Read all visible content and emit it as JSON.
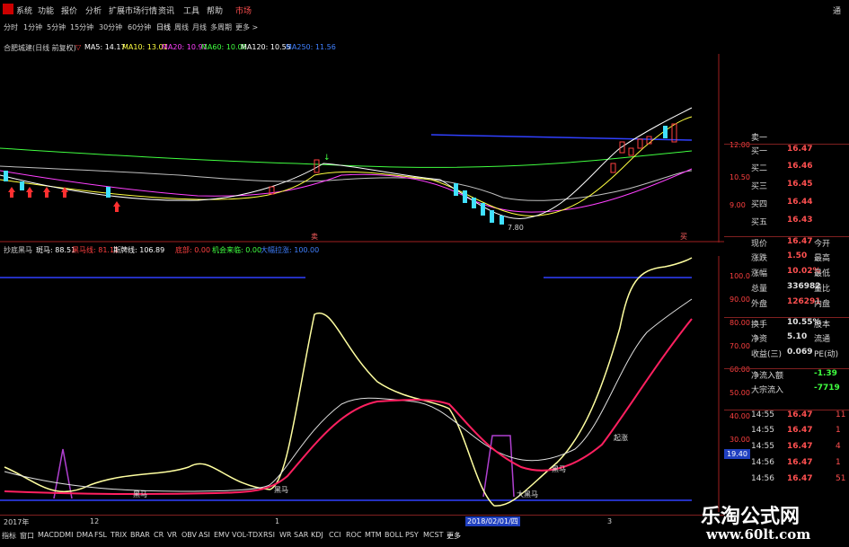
{
  "menubar": {
    "items": [
      "系统",
      "功能",
      "报价",
      "分析",
      "扩展市场行情",
      "资讯",
      "工具",
      "帮助",
      "市场"
    ],
    "right_fragment": "通"
  },
  "periods": [
    "分时",
    "1分钟",
    "5分钟",
    "15分钟",
    "30分钟",
    "60分钟",
    "日线",
    "周线",
    "月线",
    "多周期",
    "更多 >"
  ],
  "main_chart": {
    "title": "合肥城建(日线 前复权)",
    "ma": [
      {
        "label": "MA5: 14.17",
        "color": "#ffffff"
      },
      {
        "label": "MA10: 13.01",
        "color": "#ffff40"
      },
      {
        "label": "MA20: 10.91",
        "color": "#ff40ff"
      },
      {
        "label": "MA60: 10.08",
        "color": "#40ff40"
      },
      {
        "label": "MA120: 10.55",
        "color": "#ffffff"
      },
      {
        "label": "MA250: 11.56",
        "color": "#4080ff"
      }
    ],
    "y_ticks": [
      "12.00",
      "10.50",
      "9.00"
    ],
    "low_label": "7.80",
    "markers": [
      "卖",
      "买"
    ]
  },
  "sub_chart": {
    "name": "抄底黑马",
    "items": [
      {
        "label": "斑马: 88.51",
        "color": "#ffffff"
      },
      {
        "label": "黑马线: 81.11",
        "color": "#ff4040"
      },
      {
        "label": "斯牌线: 106.89",
        "color": "#ffffff"
      },
      {
        "label": "底部: 0.00",
        "color": "#ff4040"
      },
      {
        "label": "机会来临: 0.00",
        "color": "#40ff40"
      },
      {
        "label": "大幅拉涨: 100.00",
        "color": "#4080ff"
      }
    ],
    "y_ticks": [
      "100.0",
      "90.00",
      "80.00",
      "70.00",
      "60.00",
      "50.00",
      "40.00",
      "30.00",
      "19.40"
    ],
    "annotations": [
      "黑马",
      "黑马",
      "大黑马",
      "黑马",
      "起涨"
    ]
  },
  "axis": {
    "dates": [
      "2017年",
      "12",
      "1",
      "2018/02/01/四",
      "3"
    ]
  },
  "bottom_tabs": [
    "指标",
    "窗口",
    "MACD",
    "DMI",
    "DMA",
    "FSL",
    "TRIX",
    "BRAR",
    "CR",
    "VR",
    "OBV",
    "ASI",
    "EMV",
    "VOL-TDX",
    "RSI",
    "WR",
    "SAR",
    "KDJ",
    "CCI",
    "ROC",
    "MTM",
    "BOLL",
    "PSY",
    "MCST",
    "更多"
  ],
  "quote": {
    "asks": [
      {
        "label": "卖一",
        "value": ""
      },
      {
        "label": "买一",
        "value": "16.47"
      },
      {
        "label": "买二",
        "value": "16.46"
      },
      {
        "label": "买三",
        "value": "16.45"
      },
      {
        "label": "买四",
        "value": "16.44"
      },
      {
        "label": "买五",
        "value": "16.43"
      }
    ],
    "stats": [
      {
        "label": "现价",
        "value": "16.47",
        "label2": "今开"
      },
      {
        "label": "涨跌",
        "value": "1.50",
        "label2": "最高"
      },
      {
        "label": "涨幅",
        "value": "10.02%",
        "label2": "最低"
      },
      {
        "label": "总量",
        "value": "336982",
        "label2": "量比"
      },
      {
        "label": "外盘",
        "value": "126291",
        "label2": "内盘"
      },
      {
        "label": "换手",
        "value": "10.55%",
        "label2": "股本"
      },
      {
        "label": "净资",
        "value": "5.10",
        "label2": "流通"
      },
      {
        "label": "收益(三)",
        "value": "0.069",
        "label2": "PE(动)"
      },
      {
        "label": "净流入额",
        "value": "-1.39"
      },
      {
        "label": "大宗流入",
        "value": "-7719"
      }
    ],
    "ticks": [
      {
        "time": "14:55",
        "price": "16.47",
        "vol": "11"
      },
      {
        "time": "14:55",
        "price": "16.47",
        "vol": "1"
      },
      {
        "time": "14:55",
        "price": "16.47",
        "vol": "4"
      },
      {
        "time": "14:56",
        "price": "16.47",
        "vol": "1"
      },
      {
        "time": "14:56",
        "price": "16.47",
        "vol": "51"
      }
    ]
  },
  "watermark": {
    "title": "乐淘公式网",
    "url": "www.60lt.com"
  }
}
